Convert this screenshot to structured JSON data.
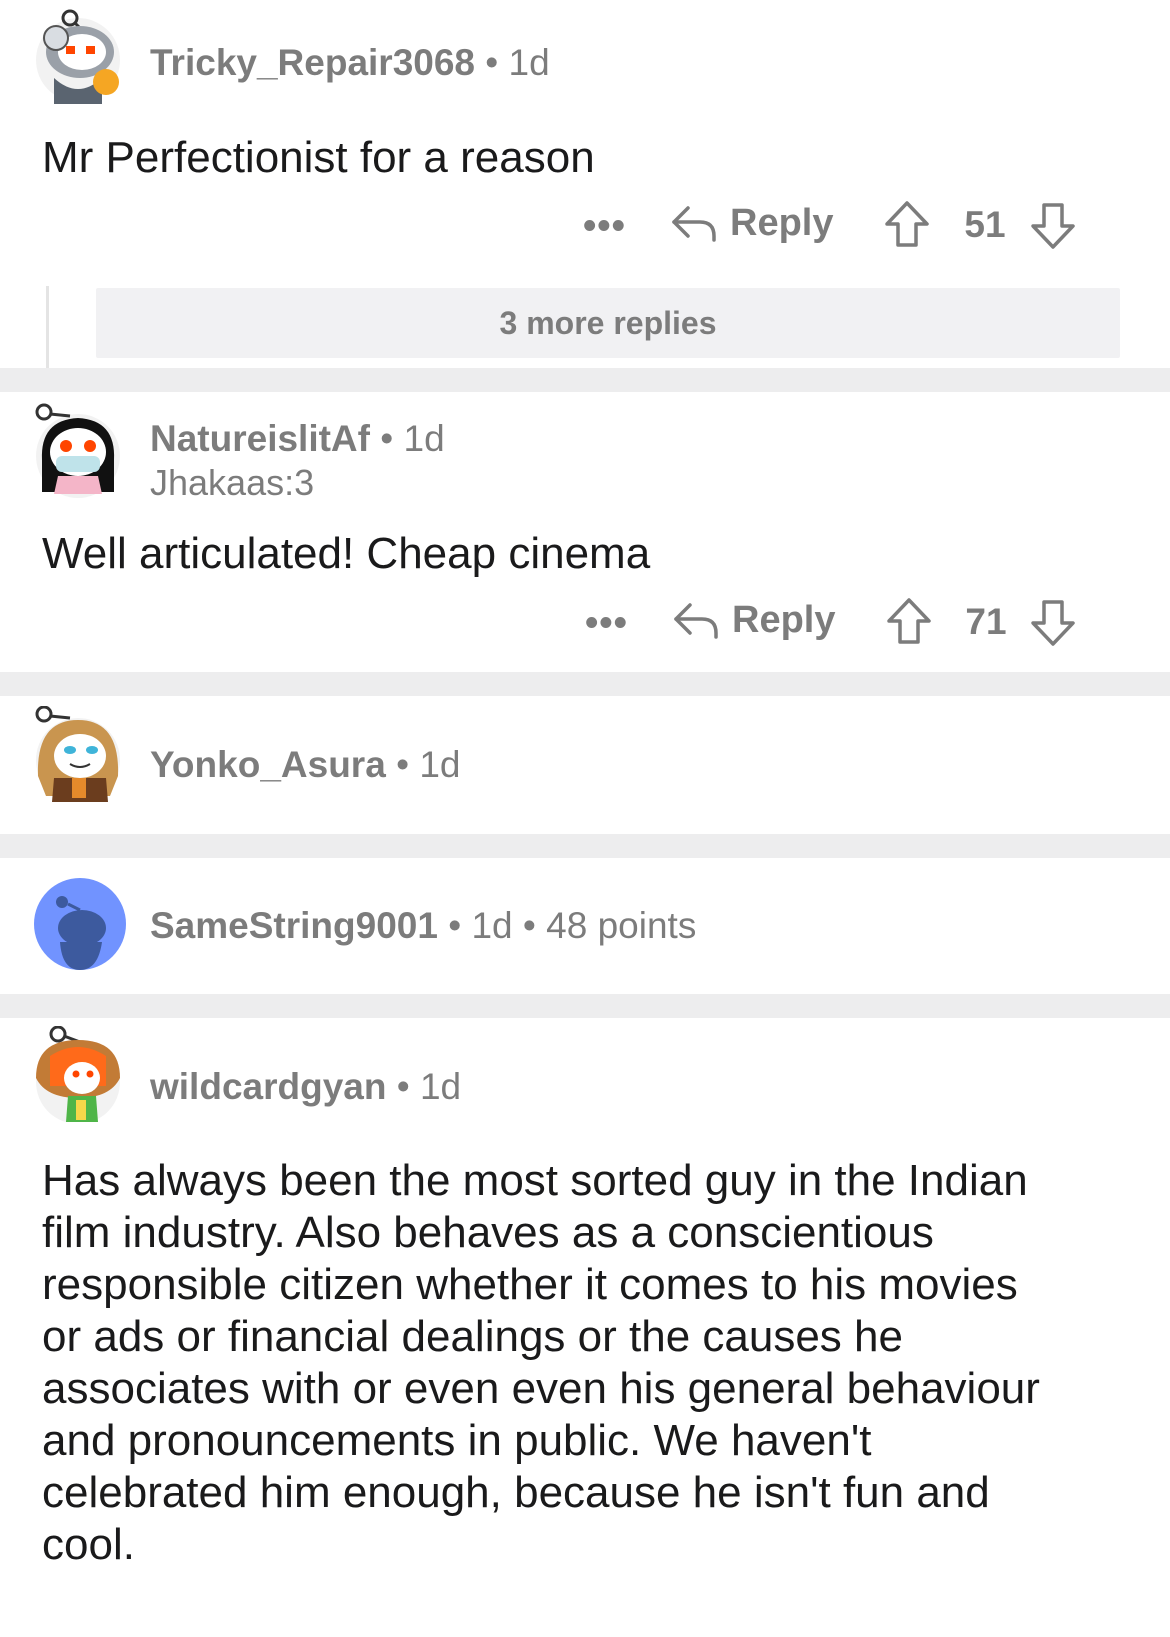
{
  "comments": [
    {
      "username": "Tricky_Repair3068",
      "age": "1d",
      "text": "Mr Perfectionist for a reason",
      "reply_label": "Reply",
      "score": "51",
      "more_replies": "3 more replies"
    },
    {
      "username": "NatureislitAf",
      "age": "1d",
      "flair": "Jhakaas:3",
      "text": "Well articulated! Cheap cinema",
      "reply_label": "Reply",
      "score": "71"
    },
    {
      "username": "Yonko_Asura",
      "age": "1d"
    },
    {
      "username": "SameString9001",
      "age": "1d",
      "points": "48 points"
    },
    {
      "username": "wildcardgyan",
      "age": "1d",
      "text": "Has always been the most sorted guy in the Indian film industry. Also behaves as a conscientious responsible citizen whether it comes to his movies or ads or financial dealings or the causes he associates with or even even his general behaviour and pronouncements in public. We haven't celebrated him enough, because he isn't fun and cool."
    }
  ],
  "separator": "•",
  "more_options": "•••",
  "colors": {
    "meta_gray": "#7c7c7c",
    "text": "#1a1a1b",
    "separator_bg": "#ededee",
    "default_avatar": "#7193ff"
  },
  "icons": [
    "reply-arrow-icon",
    "upvote-icon",
    "downvote-icon",
    "more-options-icon"
  ]
}
